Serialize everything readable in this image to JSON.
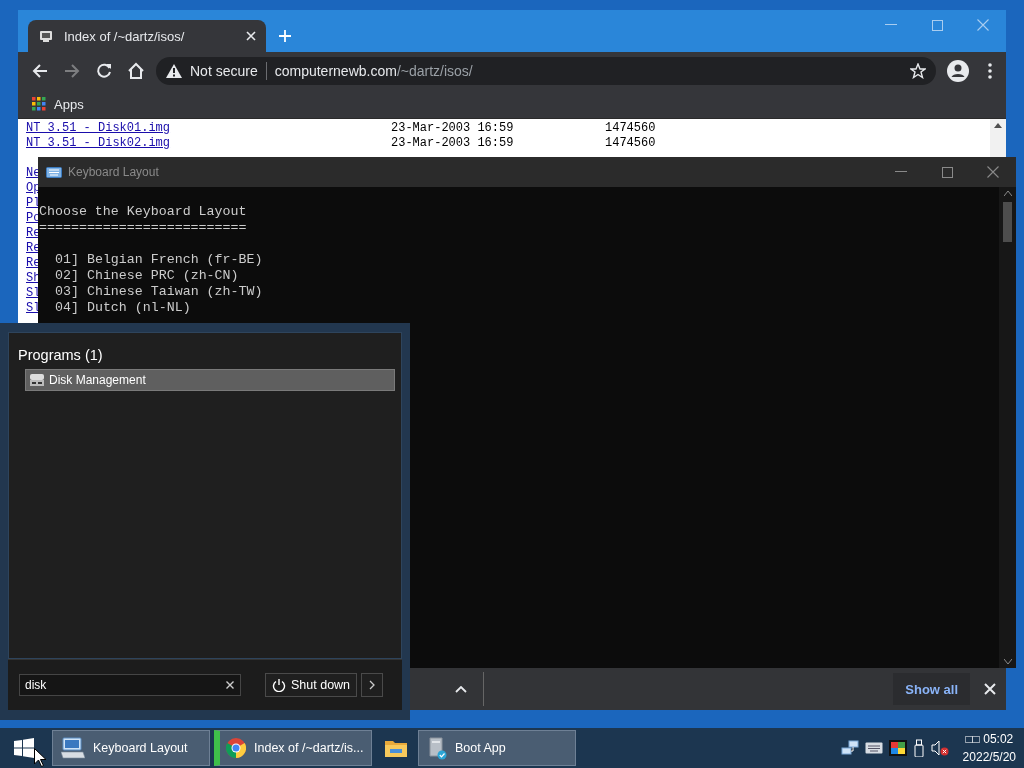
{
  "browser": {
    "tab": {
      "title": "Index of /~dartz/isos/",
      "selected": true
    },
    "nav": {
      "back": {
        "disabled": false
      },
      "forward": {
        "disabled": true
      }
    },
    "security": "Not secure",
    "url": {
      "host": "computernewb.com",
      "path": "/~dartz/isos/"
    },
    "bookmarks": [
      {
        "label": "Apps"
      }
    ],
    "listing": [
      {
        "name": "NT 3.51 - Disk01.img",
        "date": "23-Mar-2003 16:59",
        "size": "1474560"
      },
      {
        "name": "NT 3.51 - Disk02.img",
        "date": "23-Mar-2003 16:59",
        "size": "1474560"
      },
      {
        "name": "Ne"
      },
      {
        "name": "Op"
      },
      {
        "name": "Pl"
      },
      {
        "name": "Po"
      },
      {
        "name": "Re"
      },
      {
        "name": "Re"
      },
      {
        "name": "Re"
      },
      {
        "name": "Sh"
      },
      {
        "name": "Sl"
      },
      {
        "name": "Sl"
      }
    ],
    "download_bar": {
      "show_all": "Show all"
    }
  },
  "console": {
    "title": "Keyboard Layout",
    "active": false,
    "heading": "Choose the Keyboard Layout",
    "rule": "==========================",
    "options": [
      "01] Belgian French (fr-BE)",
      "02] Chinese PRC (zh-CN)",
      "03] Chinese Taiwan (zh-TW)",
      "04] Dutch (nl-NL)"
    ]
  },
  "start_menu": {
    "section": "Programs (1)",
    "results": [
      {
        "label": "Disk Management",
        "selected": true
      }
    ],
    "search": {
      "value": "disk"
    },
    "shutdown": "Shut down"
  },
  "taskbar": {
    "items": [
      {
        "kind": "keyboard",
        "label": "Keyboard Layout",
        "highlighted": false
      },
      {
        "kind": "chrome",
        "label": "Index of /~dartz/is...",
        "highlighted": true
      },
      {
        "kind": "folder"
      },
      {
        "kind": "drive",
        "label": "Boot App",
        "highlighted": false
      }
    ],
    "clock": {
      "time": "□□ 05:02",
      "date": "2022/5/20"
    }
  }
}
